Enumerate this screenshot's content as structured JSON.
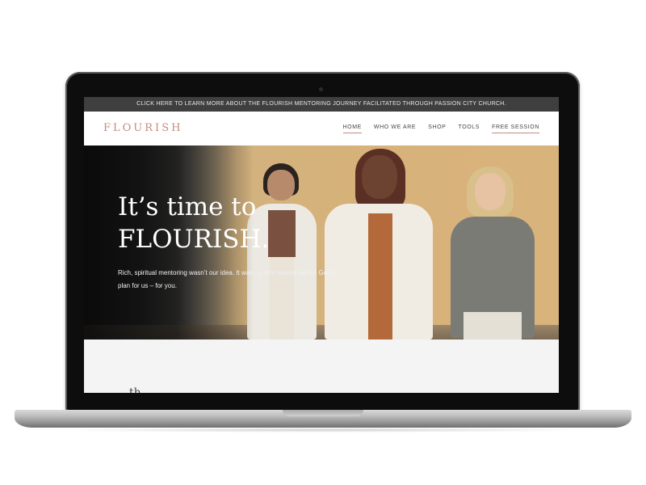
{
  "announcement": "CLICK HERE TO LEARN MORE ABOUT THE FLOURISH MENTORING JOURNEY FACILITATED THROUGH PASSION CITY CHURCH.",
  "brand": {
    "logo": "FLOURISH",
    "accent_color": "#c48b7d"
  },
  "nav": {
    "items": [
      {
        "label": "HOME"
      },
      {
        "label": "WHO WE ARE"
      },
      {
        "label": "SHOP"
      },
      {
        "label": "TOOLS"
      },
      {
        "label": "FREE SESSION"
      }
    ]
  },
  "hero": {
    "title_line1": "It’s time to",
    "title_line2": "FLOURISH.",
    "subtitle": "Rich, spiritual mentoring wasn’t our idea. It was, is, and always will be God’s plan for us – for you."
  },
  "below": {
    "partial_text": "th"
  }
}
